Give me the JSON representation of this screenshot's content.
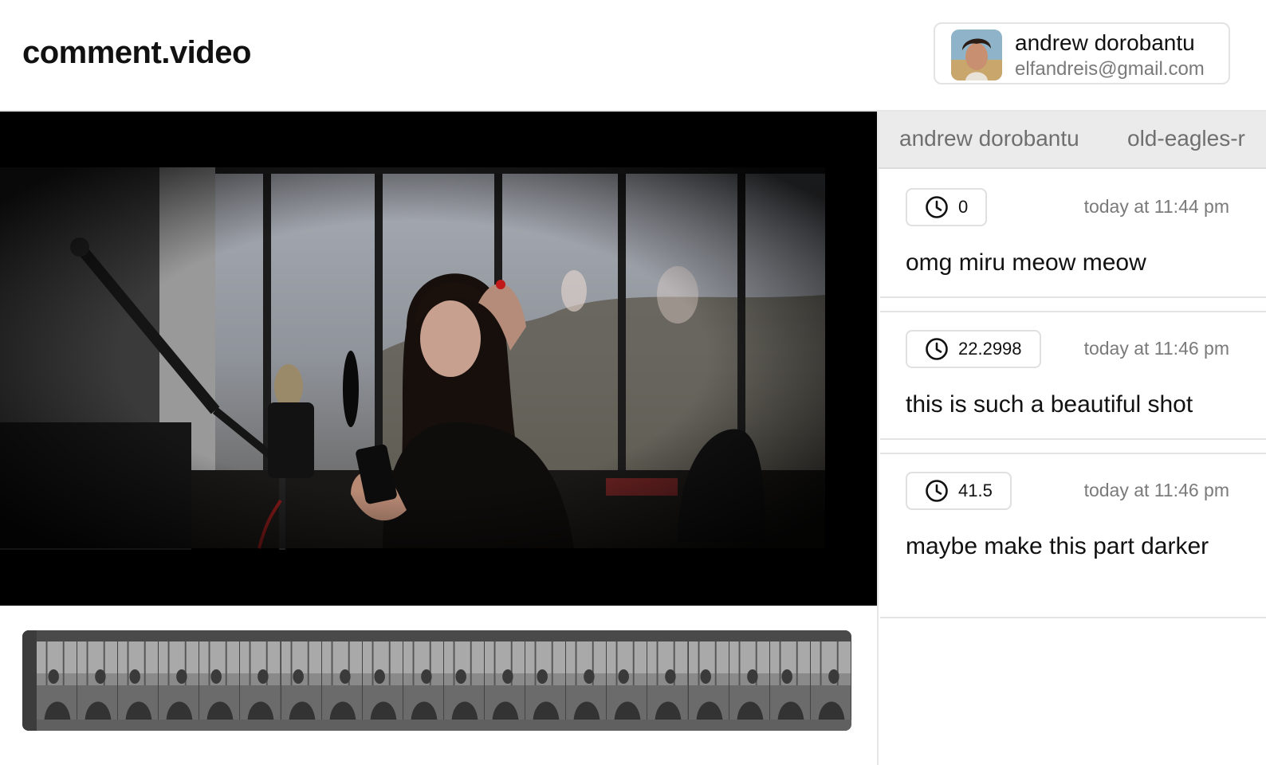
{
  "app": {
    "title": "comment.video"
  },
  "user": {
    "name": "andrew dorobantu",
    "email": "elfandreis@gmail.com"
  },
  "sidebar": {
    "tabs": [
      {
        "label": "andrew dorobantu"
      },
      {
        "label": "old-eagles-r"
      }
    ],
    "comments": [
      {
        "time": "0",
        "timestamp": "today at 11:44 pm",
        "text": "omg miru meow meow"
      },
      {
        "time": "22.2998",
        "timestamp": "today at 11:46 pm",
        "text": "this is such a beautiful shot"
      },
      {
        "time": "41.5",
        "timestamp": "today at 11:46 pm",
        "text": "maybe make this part darker"
      }
    ]
  },
  "timeline": {
    "frame_count": 20,
    "playhead_position": 0
  },
  "icons": {
    "clock": "clock-icon"
  },
  "colors": {
    "accent": "#111111",
    "muted": "#7a7a7a",
    "tab_bar": "#ebebeb"
  }
}
